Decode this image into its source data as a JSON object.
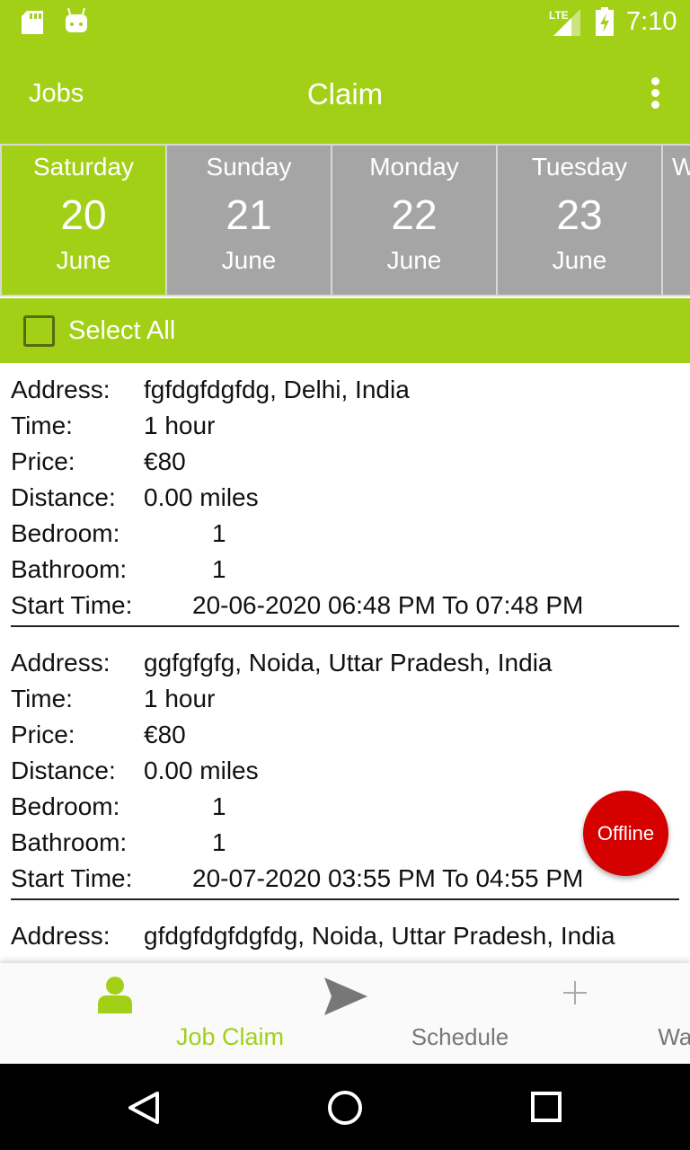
{
  "status_bar": {
    "time": "7:10",
    "network": "LTE",
    "icons": [
      "sd-card-icon",
      "android-icon",
      "signal-icon",
      "battery-charging-icon"
    ]
  },
  "app_bar": {
    "left_label": "Jobs",
    "title": "Claim",
    "menu_icon": "more-vert-icon"
  },
  "days": [
    {
      "name": "Saturday",
      "date": "20",
      "month": "June",
      "selected": true
    },
    {
      "name": "Sunday",
      "date": "21",
      "month": "June"
    },
    {
      "name": "Monday",
      "date": "22",
      "month": "June"
    },
    {
      "name": "Tuesday",
      "date": "23",
      "month": "June"
    },
    {
      "name": "W",
      "date": "",
      "month": ""
    }
  ],
  "select_all": {
    "label": "Select All",
    "checked": false
  },
  "labels": {
    "address": "Address:",
    "time": "Time:",
    "price": "Price:",
    "distance": "Distance:",
    "bedroom": "Bedroom:",
    "bathroom": "Bathroom:",
    "start_time": "Start Time:"
  },
  "jobs": [
    {
      "address": "fgfdgfdgfdg, Delhi, India",
      "time": "1 hour",
      "price": "€80",
      "distance": "0.00 miles",
      "bedroom": "1",
      "bathroom": "1",
      "start_time": "20-06-2020 06:48 PM To 07:48 PM"
    },
    {
      "address": "ggfgfgfg, Noida, Uttar Pradesh, India",
      "time": "1 hour",
      "price": "€80",
      "distance": "0.00 miles",
      "bedroom": "1",
      "bathroom": "1",
      "start_time": "20-07-2020 03:55 PM To 04:55 PM"
    },
    {
      "address": "gfdgfdgfdgfdg, Noida, Uttar Pradesh, India"
    }
  ],
  "fab": {
    "label": "Offline",
    "color": "#d50000"
  },
  "bottom_nav": [
    {
      "label": "Job Claim",
      "icon": "person-icon",
      "active": true
    },
    {
      "label": "Schedule",
      "icon": "send-icon"
    },
    {
      "label": "Wallet",
      "icon": "plus-icon"
    }
  ],
  "colors": {
    "accent": "#a2d016",
    "tab_inactive": "#a5a5a5"
  }
}
